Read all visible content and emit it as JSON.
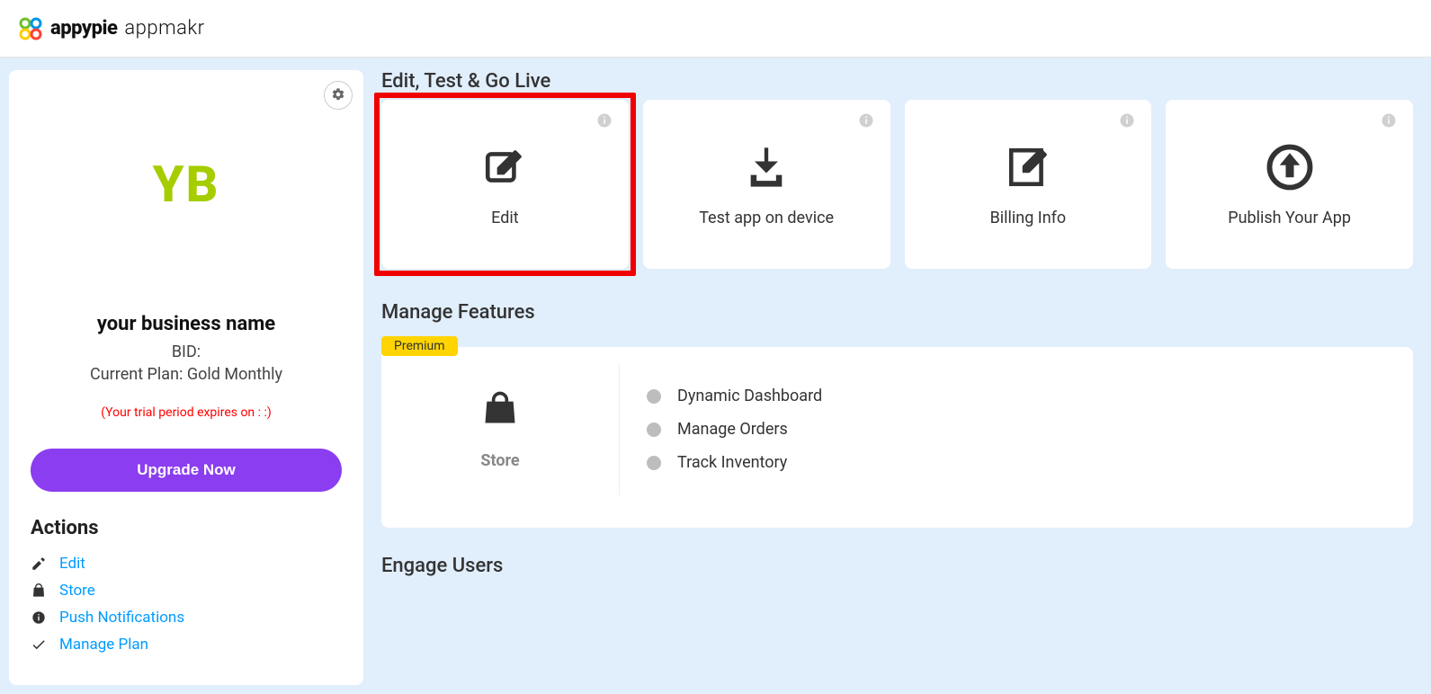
{
  "brand": {
    "name": "appypie",
    "sub": "appmakr"
  },
  "sidebar": {
    "app_logo_text": "YB",
    "app_name": "your business name",
    "bid_label": "BID:",
    "plan_text": "Current Plan: Gold Monthly",
    "trial_text": "(Your trial period expires on :                        :)",
    "upgrade_label": "Upgrade Now",
    "actions_title": "Actions",
    "actions": [
      {
        "label": "Edit",
        "icon": "edit"
      },
      {
        "label": "Store",
        "icon": "bag"
      },
      {
        "label": "Push Notifications",
        "icon": "info"
      },
      {
        "label": "Manage Plan",
        "icon": "check"
      }
    ]
  },
  "main": {
    "edit_section_title": "Edit, Test & Go Live",
    "cards": [
      {
        "label": "Edit",
        "icon": "edit",
        "highlight": true
      },
      {
        "label": "Test app on device",
        "icon": "download",
        "highlight": false
      },
      {
        "label": "Billing Info",
        "icon": "note-edit",
        "highlight": false
      },
      {
        "label": "Publish Your App",
        "icon": "upload-circle",
        "highlight": false
      }
    ],
    "features_title": "Manage Features",
    "premium_label": "Premium",
    "feature_name": "Store",
    "feature_items": [
      "Dynamic Dashboard",
      "Manage Orders",
      "Track Inventory"
    ],
    "engage_title": "Engage Users"
  }
}
